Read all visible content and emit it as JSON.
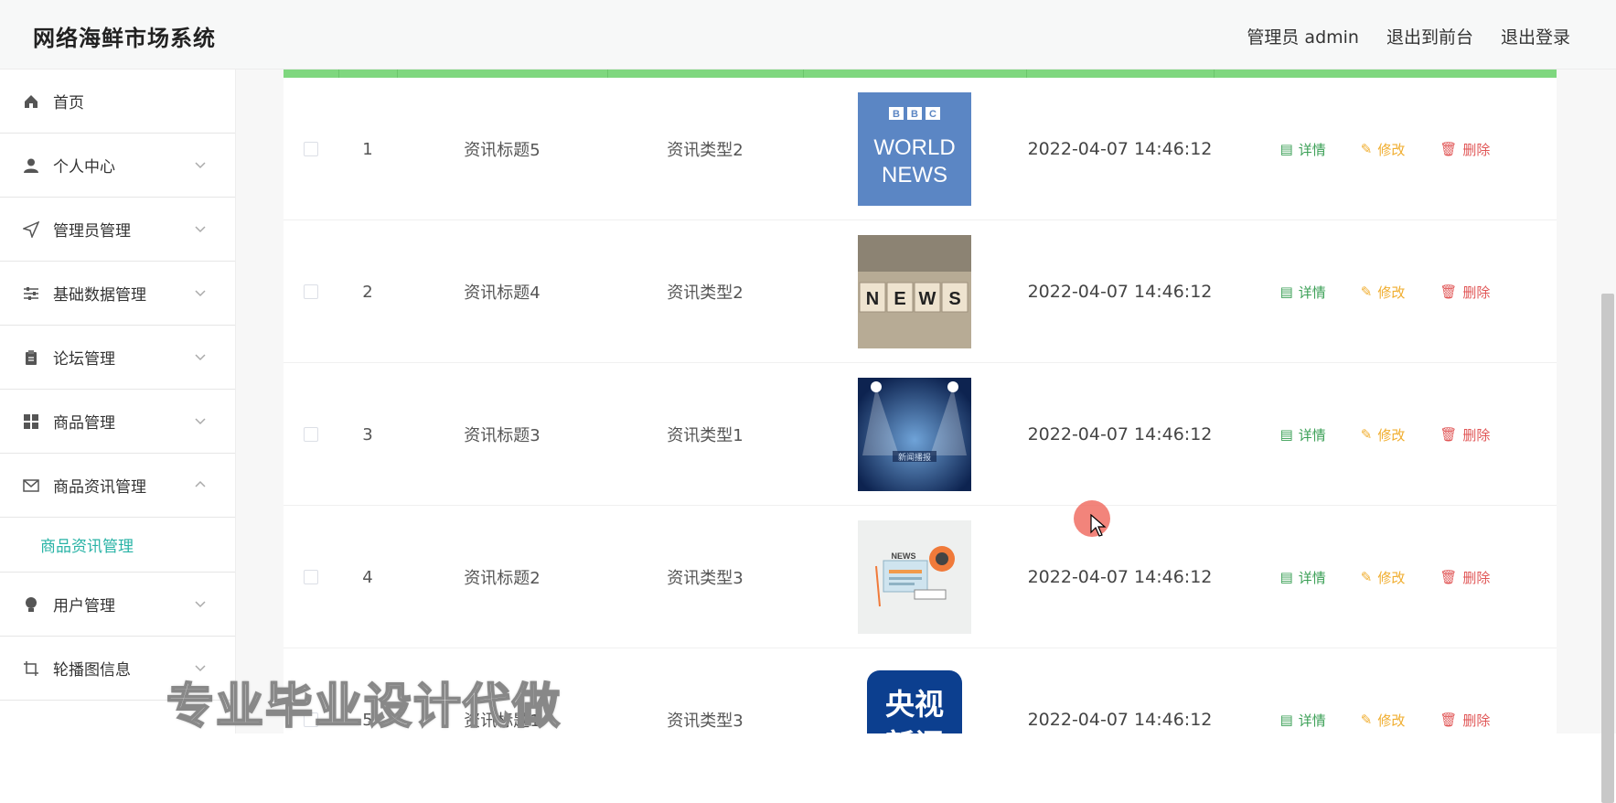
{
  "app": {
    "title": "网络海鲜市场系统"
  },
  "header": {
    "user_label": "管理员 admin",
    "front_label": "退出到前台",
    "logout_label": "退出登录"
  },
  "sidebar": {
    "items": [
      {
        "label": "首页",
        "icon": "home-icon"
      },
      {
        "label": "个人中心",
        "icon": "user-icon"
      },
      {
        "label": "管理员管理",
        "icon": "send-icon"
      },
      {
        "label": "基础数据管理",
        "icon": "sliders-icon"
      },
      {
        "label": "论坛管理",
        "icon": "clipboard-icon"
      },
      {
        "label": "商品管理",
        "icon": "grid-icon"
      },
      {
        "label": "商品资讯管理",
        "icon": "mail-icon"
      },
      {
        "label": "用户管理",
        "icon": "bulb-icon"
      },
      {
        "label": "轮播图信息",
        "icon": "crop-icon"
      }
    ],
    "active_sub": "商品资讯管理"
  },
  "table": {
    "accent_color": "#7fd77f",
    "rows": [
      {
        "index": "1",
        "title": "资讯标题5",
        "type": "资讯类型2",
        "image": "BBC WORLD NEWS",
        "time": "2022-04-07 14:46:12"
      },
      {
        "index": "2",
        "title": "资讯标题4",
        "type": "资讯类型2",
        "image": "NEWS",
        "time": "2022-04-07 14:46:12"
      },
      {
        "index": "3",
        "title": "资讯标题3",
        "type": "资讯类型1",
        "image": "新闻播报",
        "time": "2022-04-07 14:46:12"
      },
      {
        "index": "4",
        "title": "资讯标题2",
        "type": "资讯类型3",
        "image": "NEWS",
        "time": "2022-04-07 14:46:12"
      },
      {
        "index": "5",
        "title": "资讯标题1",
        "type": "资讯类型3",
        "image": "央视新闻",
        "time": "2022-04-07 14:46:12"
      }
    ],
    "actions": {
      "detail": "详情",
      "edit": "修改",
      "delete": "删除"
    }
  },
  "watermark": "专业毕业设计代做"
}
